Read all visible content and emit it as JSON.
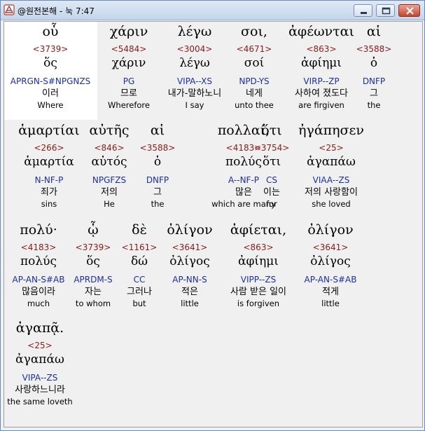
{
  "window": {
    "title": "@원전본해 - 눅 7:47"
  },
  "rows": [
    {
      "words": [
        {
          "greek": "οὗ",
          "strong": "<3739>",
          "lemma": "ὅς",
          "parsing": "APRGN-S#NPGNZS",
          "korean": "이러",
          "english": "Where"
        },
        {
          "greek": "χάριν",
          "strong": "<5484>",
          "lemma": "χάριν",
          "parsing": "PG",
          "korean": "므로",
          "english": "Wherefore"
        },
        {
          "greek": "λέγω",
          "strong": "<3004>",
          "lemma": "λέγω",
          "parsing": "VIPA--XS",
          "korean": "내가-말하노니",
          "english": "I say"
        },
        {
          "greek": "σοι,",
          "strong": "<4671>",
          "lemma": "σοί",
          "parsing": "NPD-YS",
          "korean": "네게",
          "english": "unto thee"
        },
        {
          "greek": "ἀφέωνται",
          "strong": "<863>",
          "lemma": "ἀφίημι",
          "parsing": "VIRP--ZP",
          "korean": "사하여 졌도다",
          "english": "are firgiven"
        },
        {
          "greek": "αἱ",
          "strong": "<3588>",
          "lemma": "ὁ",
          "parsing": "DNFP",
          "korean": "그",
          "english": "the"
        }
      ]
    },
    {
      "words": [
        {
          "greek": "ἁμαρτίαι",
          "strong": "<266>",
          "lemma": "ἁμαρτία",
          "parsing": "N-NF-P",
          "korean": "죄가",
          "english": "sins"
        },
        {
          "greek": "αὐτῆς",
          "strong": "<846>",
          "lemma": "αὐτός",
          "parsing": "NPGFZS",
          "korean": "저의",
          "english": "He"
        },
        {
          "greek": "αἱ",
          "strong": "<3588>",
          "lemma": "ὁ",
          "parsing": "DNFP",
          "korean": "그",
          "english": "the"
        },
        {
          "greek": "πολλαί,",
          "strong": "<4183>",
          "lemma": "πολύς",
          "parsing": "A--NF-P",
          "korean": "많은",
          "english": "which are many"
        },
        {
          "greek": "ὅτι",
          "strong": "<3754>",
          "lemma": "ὅτι",
          "parsing": "CS",
          "korean": "이는",
          "english": "for"
        },
        {
          "greek": "ἠγάπησεν",
          "strong": "<25>",
          "lemma": "ἀγαπάω",
          "parsing": "VIAA--ZS",
          "korean": "저의 사랑함이",
          "english": "she loved"
        }
      ]
    },
    {
      "words": [
        {
          "greek": "πολύ·",
          "strong": "<4183>",
          "lemma": "πολύς",
          "parsing": "AP-AN-S#AB",
          "korean": "많음이라",
          "english": "much"
        },
        {
          "greek": "ᾧ",
          "strong": "<3739>",
          "lemma": "ὅς",
          "parsing": "APRDM-S",
          "korean": "자는",
          "english": "to whom"
        },
        {
          "greek": "δὲ",
          "strong": "<1161>",
          "lemma": "δώ",
          "parsing": "CC",
          "korean": "그러나",
          "english": "but"
        },
        {
          "greek": "ὀλίγον",
          "strong": "<3641>",
          "lemma": "ὀλίγος",
          "parsing": "AP-NN-S",
          "korean": "적은",
          "english": "little"
        },
        {
          "greek": "ἀφίεται,",
          "strong": "<863>",
          "lemma": "ἀφίημι",
          "parsing": "VIPP--ZS",
          "korean": "사람 받은 일이",
          "english": "is forgiven"
        },
        {
          "greek": "ὀλίγον",
          "strong": "<3641>",
          "lemma": "ὀλίγος",
          "parsing": "AP-AN-S#AB",
          "korean": "적게",
          "english": "little"
        }
      ]
    },
    {
      "words": [
        {
          "greek": "ἀγαπᾷ.",
          "strong": "<25>",
          "lemma": "ἀγαπάω",
          "parsing": "VIPA--ZS",
          "korean": "사랑하느니라",
          "english": "the same loveth"
        }
      ]
    }
  ]
}
